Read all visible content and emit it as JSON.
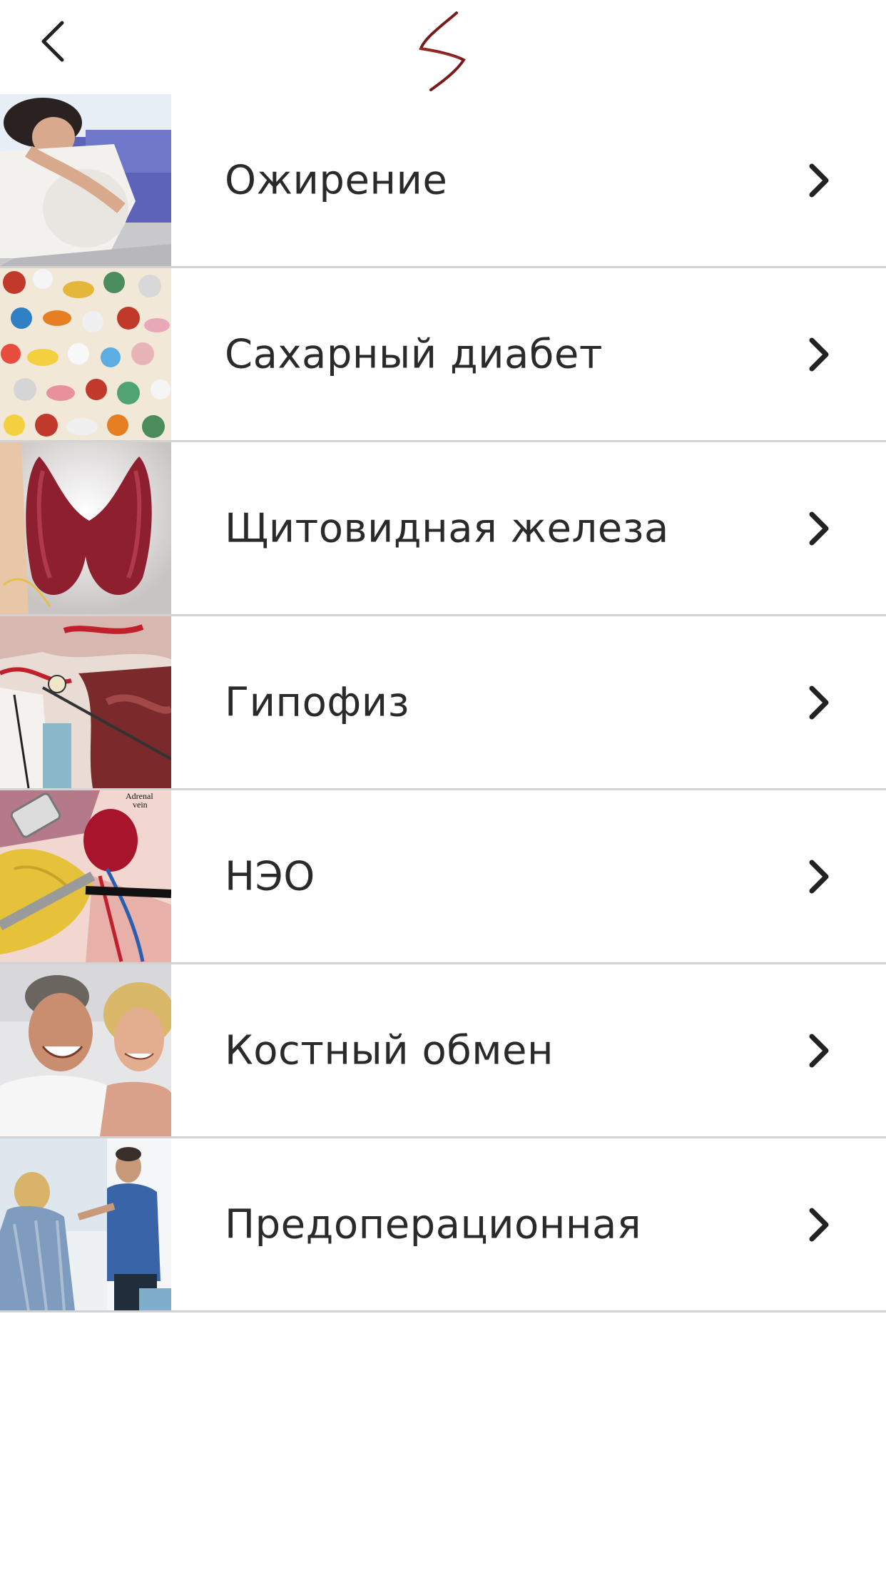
{
  "header": {
    "back_icon": "chevron-left-icon",
    "logo_icon": "s-signature-logo",
    "logo_color": "#7a1a1a"
  },
  "menu": {
    "items": [
      {
        "label": "Ожирение",
        "thumb": "obesity-photo"
      },
      {
        "label": "Сахарный диабет",
        "thumb": "pills-photo"
      },
      {
        "label": "Щитовидная железа",
        "thumb": "thyroid-illustration"
      },
      {
        "label": "Гипофиз",
        "thumb": "pituitary-illustration"
      },
      {
        "label": "НЭО",
        "thumb": "adrenal-illustration",
        "thumb_caption": "Adrenal vein"
      },
      {
        "label": "Костный обмен",
        "thumb": "couple-photo"
      },
      {
        "label": "Предоперационная",
        "thumb": "doctor-patient-photo"
      }
    ],
    "chevron_icon": "chevron-right-icon"
  }
}
